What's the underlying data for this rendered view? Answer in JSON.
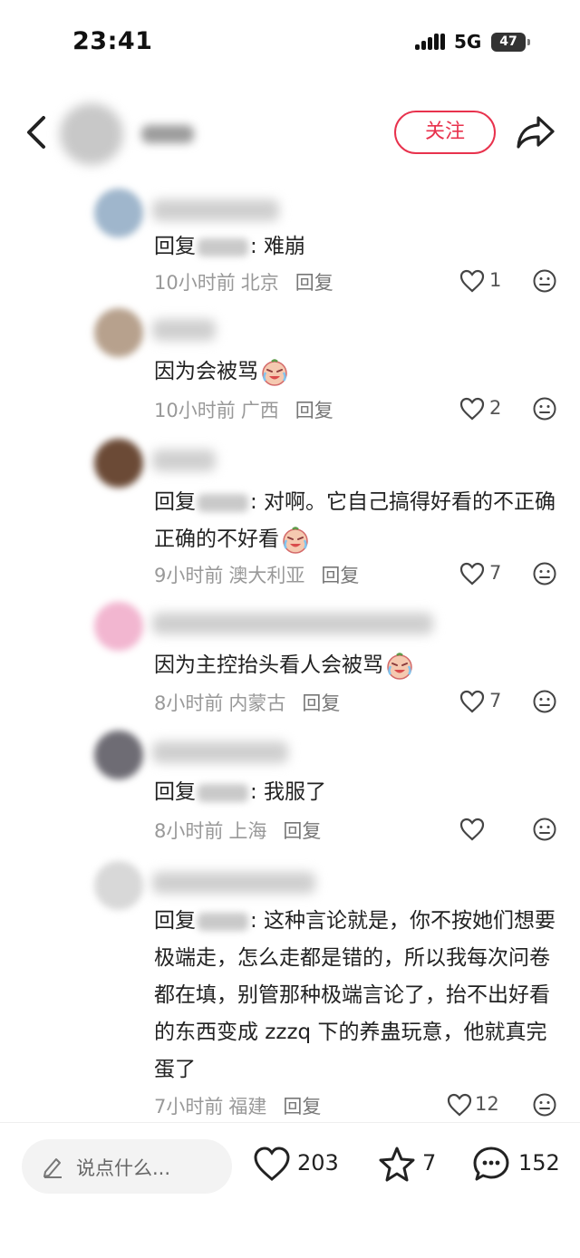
{
  "status": {
    "time": "23:41",
    "network": "5G",
    "battery": "47"
  },
  "header": {
    "follow_label": "关注"
  },
  "comments": [
    {
      "prefix": "回复",
      "text": ": 难崩",
      "time": "10小时前",
      "location": "北京",
      "reply_label": "回复",
      "likes": "1"
    },
    {
      "prefix": "",
      "text": "因为会被骂",
      "time": "10小时前",
      "location": "广西",
      "reply_label": "回复",
      "likes": "2"
    },
    {
      "prefix": "回复",
      "text": ": 对啊。它自己搞得好看的不正确正确的不好看",
      "time": "9小时前",
      "location": "澳大利亚",
      "reply_label": "回复",
      "likes": "7"
    },
    {
      "prefix": "",
      "text": "因为主控抬头看人会被骂",
      "time": "8小时前",
      "location": "内蒙古",
      "reply_label": "回复",
      "likes": "7"
    },
    {
      "prefix": "回复",
      "text": ": 我服了",
      "time": "8小时前",
      "location": "上海",
      "reply_label": "回复",
      "likes": ""
    },
    {
      "prefix": "回复",
      "text": ": 这种言论就是，你不按她们想要极端走，怎么走都是错的，所以我每次问卷都在填，别管那种极端言论了，抬不出好看的东西变成 zzzq 下的养蛊玩意，他就真完蛋了",
      "time": "7小时前",
      "location": "福建",
      "reply_label": "回复",
      "likes": "12"
    }
  ],
  "bottom": {
    "placeholder": "说点什么...",
    "likes": "203",
    "favorites": "7",
    "comments": "152"
  }
}
